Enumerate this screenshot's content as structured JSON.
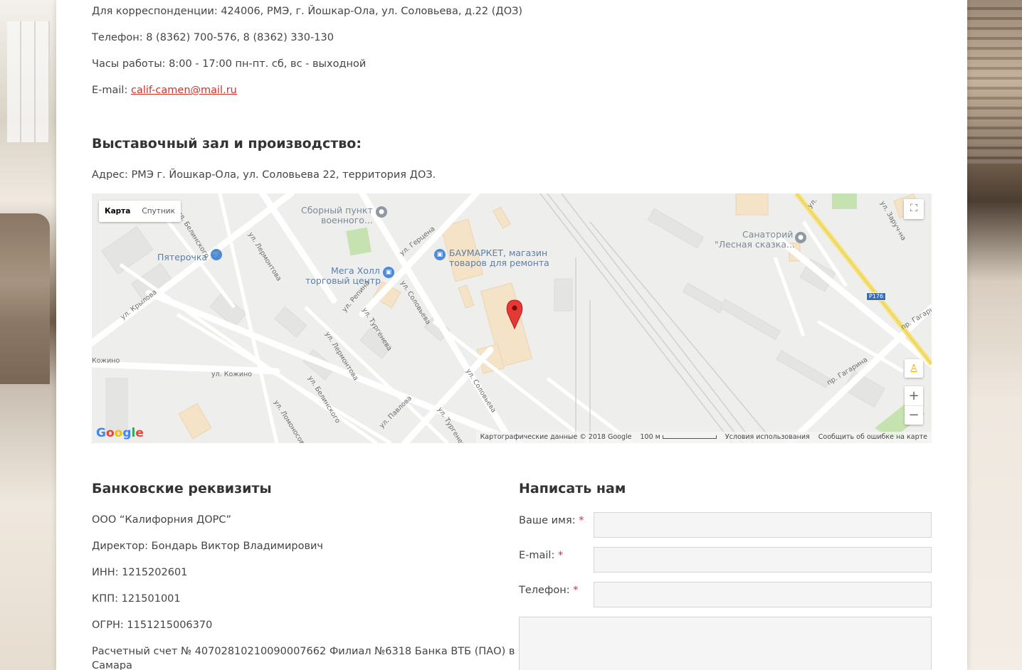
{
  "contacts": {
    "correspondence": "Для корреспонденции: 424006, РМЭ, г. Йошкар-Ола, ул. Соловьева, д.22 (ДОЗ)",
    "phone": "Телефон: 8 (8362) 700-576, 8 (8362) 330-130",
    "hours": "Часы работы: 8:00 - 17:00 пн-пт. сб, вс - выходной",
    "email_label": "E-mail: ",
    "email": "calif-camen@mail.ru"
  },
  "showroom": {
    "heading": "Выставочный зал и производство:",
    "address": "Адрес: РМЭ г. Йошкар-Ола, ул. Соловьева 22, территория ДОЗ."
  },
  "map": {
    "type_map": "Карта",
    "type_satellite": "Спутник",
    "zoom_in": "+",
    "zoom_out": "−",
    "poi_labels": {
      "sborny_1": "Сборный пункт",
      "sborny_2": "военного...",
      "pyaterochka": "Пятерочка",
      "megaholl_1": "Мега Холл",
      "megaholl_2": "торговый центр",
      "baumarket_1": "БАУМАРКЕТ, магазин",
      "baumarket_2": "товаров для ремонта",
      "sanatory_1": "Санаторий",
      "sanatory_2": "\"Лесная сказка..."
    },
    "streets": {
      "krylova": "ул. Крылова",
      "belinskogo1": "ул. Белинского",
      "lermontova1": "ул. Лермонтова",
      "gerzena": "ул. Герцена",
      "solovyeva1": "ул. Соловьева",
      "repina": "ул. Репина",
      "turgeneva1": "ул. Тургенева",
      "lermontova2": "ул. Лермонтова",
      "kozhino1": "Кожино",
      "kozhino2": "ул. Кожино",
      "belinskogo2": "ул. Белинского",
      "lomonosova": "ул. Ломоносова",
      "pavlova": "ул. Павлова",
      "turgeneva2": "ул. Тургенева",
      "solovyeva2": "ул. Соловьева",
      "gagarina1": "пр. Гагарина",
      "gagarina2": "пр. Гагарина",
      "ul": "ул.",
      "zarucheynaya": "ул. Заруч-на"
    },
    "road_shield": "Р176",
    "attribution_data": "Картографические данные © 2018 Google",
    "scale": "100 м",
    "terms": "Условия использования",
    "report": "Сообщить об ошибке на карте",
    "google_letters": [
      "G",
      "o",
      "o",
      "g",
      "l",
      "e"
    ],
    "google_colors": [
      "#4285f4",
      "#ea4335",
      "#fbbc05",
      "#4285f4",
      "#34a853",
      "#ea4335"
    ]
  },
  "bank": {
    "heading": "Банковские реквизиты",
    "company": "ООО “Калифорния ДОРС”",
    "director": "Директор: Бондарь Виктор Владимирович",
    "inn": "ИНН: 1215202601",
    "kpp": "КПП: 121501001",
    "ogrn": "ОГРН: 1151215006370",
    "account_1": "Расчетный счет № 40702810210090007662 Филиал №6318 Банка ВТБ (ПАО) в г.",
    "account_2": "Самара"
  },
  "contact_form": {
    "heading": "Написать нам",
    "name_label": "Ваше имя:",
    "email_label": "E-mail:",
    "phone_label": "Телефон:",
    "required_mark": "*"
  },
  "colors": {
    "link": "#d2322d",
    "pin": "#e53935",
    "highway": "#f6e27a"
  }
}
